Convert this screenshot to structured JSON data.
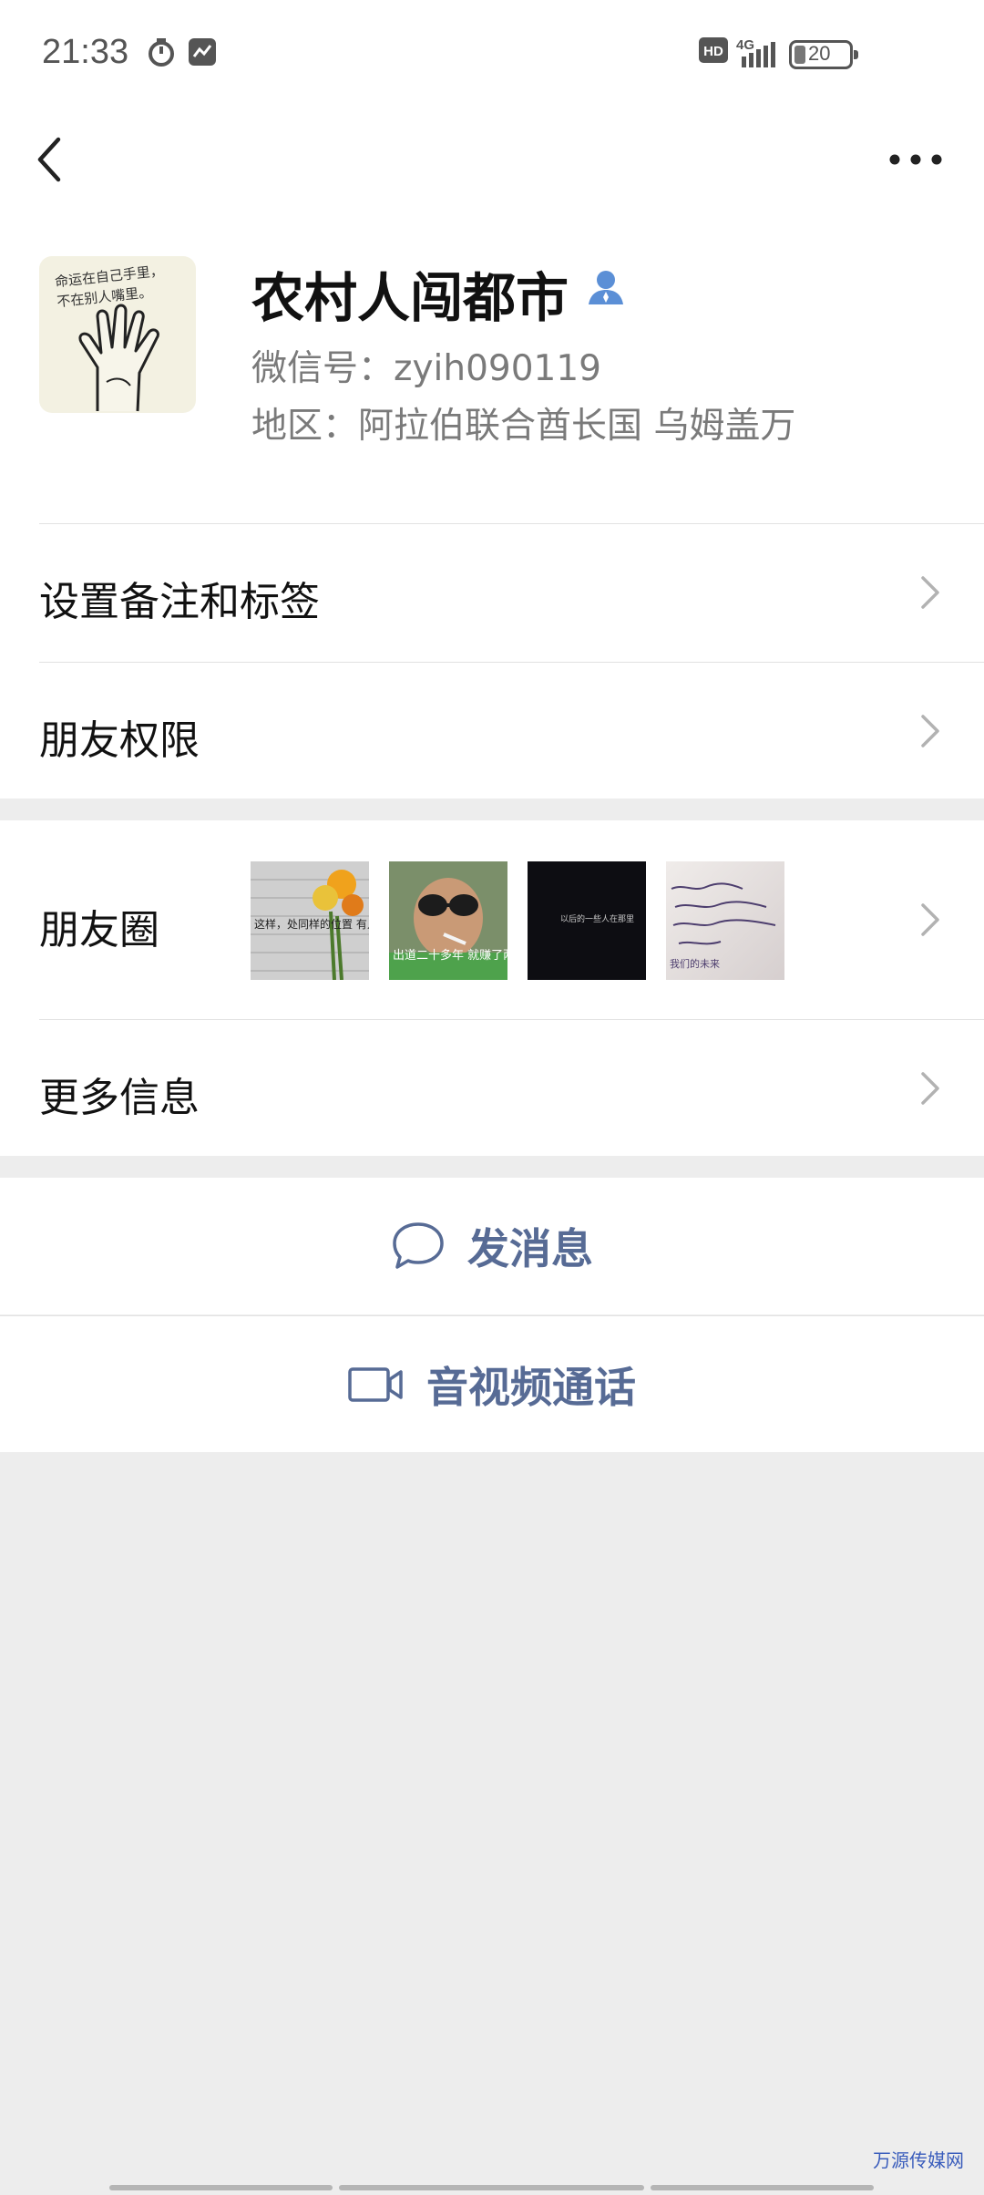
{
  "status_bar": {
    "time": "21:33",
    "icons": [
      "timer-icon",
      "app-notification-icon",
      "hd-icon",
      "signal-4g-icon"
    ],
    "network": "4G",
    "hd_label": "HD",
    "battery": "20"
  },
  "nav": {
    "back_icon": "chevron-left-icon",
    "more_icon": "more-dots-icon"
  },
  "profile": {
    "avatar_text": "命运在自己手里，\n不在别人嘴里。",
    "nickname": "农村人闯都市",
    "person_icon": "person-icon",
    "wechat_id": "微信号：zyih090119",
    "region": "地区：阿拉伯联合酋长国  乌姆盖万"
  },
  "rows": {
    "remark": "设置备注和标签",
    "permissions": "朋友权限",
    "moments": "朋友圈",
    "more_info": "更多信息"
  },
  "moments_thumbs": [
    {
      "caption": "这样，处同样的位置 有人笑，有人说"
    },
    {
      "caption": "出道二十多年 就赚了两个亿"
    },
    {
      "caption": "以后的一些人在那里"
    },
    {
      "caption": "我们的未来"
    }
  ],
  "actions": {
    "message": "发消息",
    "call": "音视频通话"
  },
  "watermark": "万源传媒网",
  "colors": {
    "accent": "#576b95",
    "background": "#ededed",
    "person_icon": "#5b8fd6"
  }
}
